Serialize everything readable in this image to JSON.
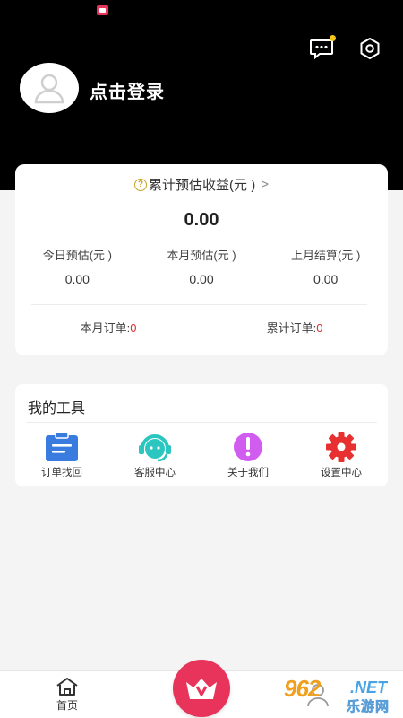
{
  "header": {
    "login_text": "点击登录",
    "message_icon": "message-dots-icon",
    "settings_icon": "gear-icon",
    "avatar_icon": "user-avatar-icon"
  },
  "earnings": {
    "title": "累计预估收益(元 )",
    "help_icon": "question-circle-icon",
    "total": "0.00",
    "stats": [
      {
        "label": "今日预估(元 )",
        "value": "0.00"
      },
      {
        "label": "本月预估(元 )",
        "value": "0.00"
      },
      {
        "label": "上月结算(元 )",
        "value": "0.00"
      }
    ],
    "orders": [
      {
        "label": "本月订单:",
        "count": "0"
      },
      {
        "label": "累计订单:",
        "count": "0"
      }
    ]
  },
  "tools": {
    "title": "我的工具",
    "items": [
      {
        "label": "订单找回",
        "icon": "clipboard-icon",
        "color": "#3a7be0"
      },
      {
        "label": "客服中心",
        "icon": "headset-icon",
        "color": "#2bc6c0"
      },
      {
        "label": "关于我们",
        "icon": "exclamation-icon",
        "color": "#d15cf0"
      },
      {
        "label": "设置中心",
        "icon": "gear-icon",
        "color": "#e83030"
      }
    ]
  },
  "bottom_nav": {
    "home_label": "首页",
    "home_icon": "home-icon",
    "center_icon": "crown-v-icon"
  },
  "watermark": {
    "number": "962",
    "suffix": ".NET",
    "cn": "乐游网"
  },
  "colors": {
    "accent": "#e8335a",
    "header_bg": "#000000",
    "count_red": "#e02a2a"
  }
}
